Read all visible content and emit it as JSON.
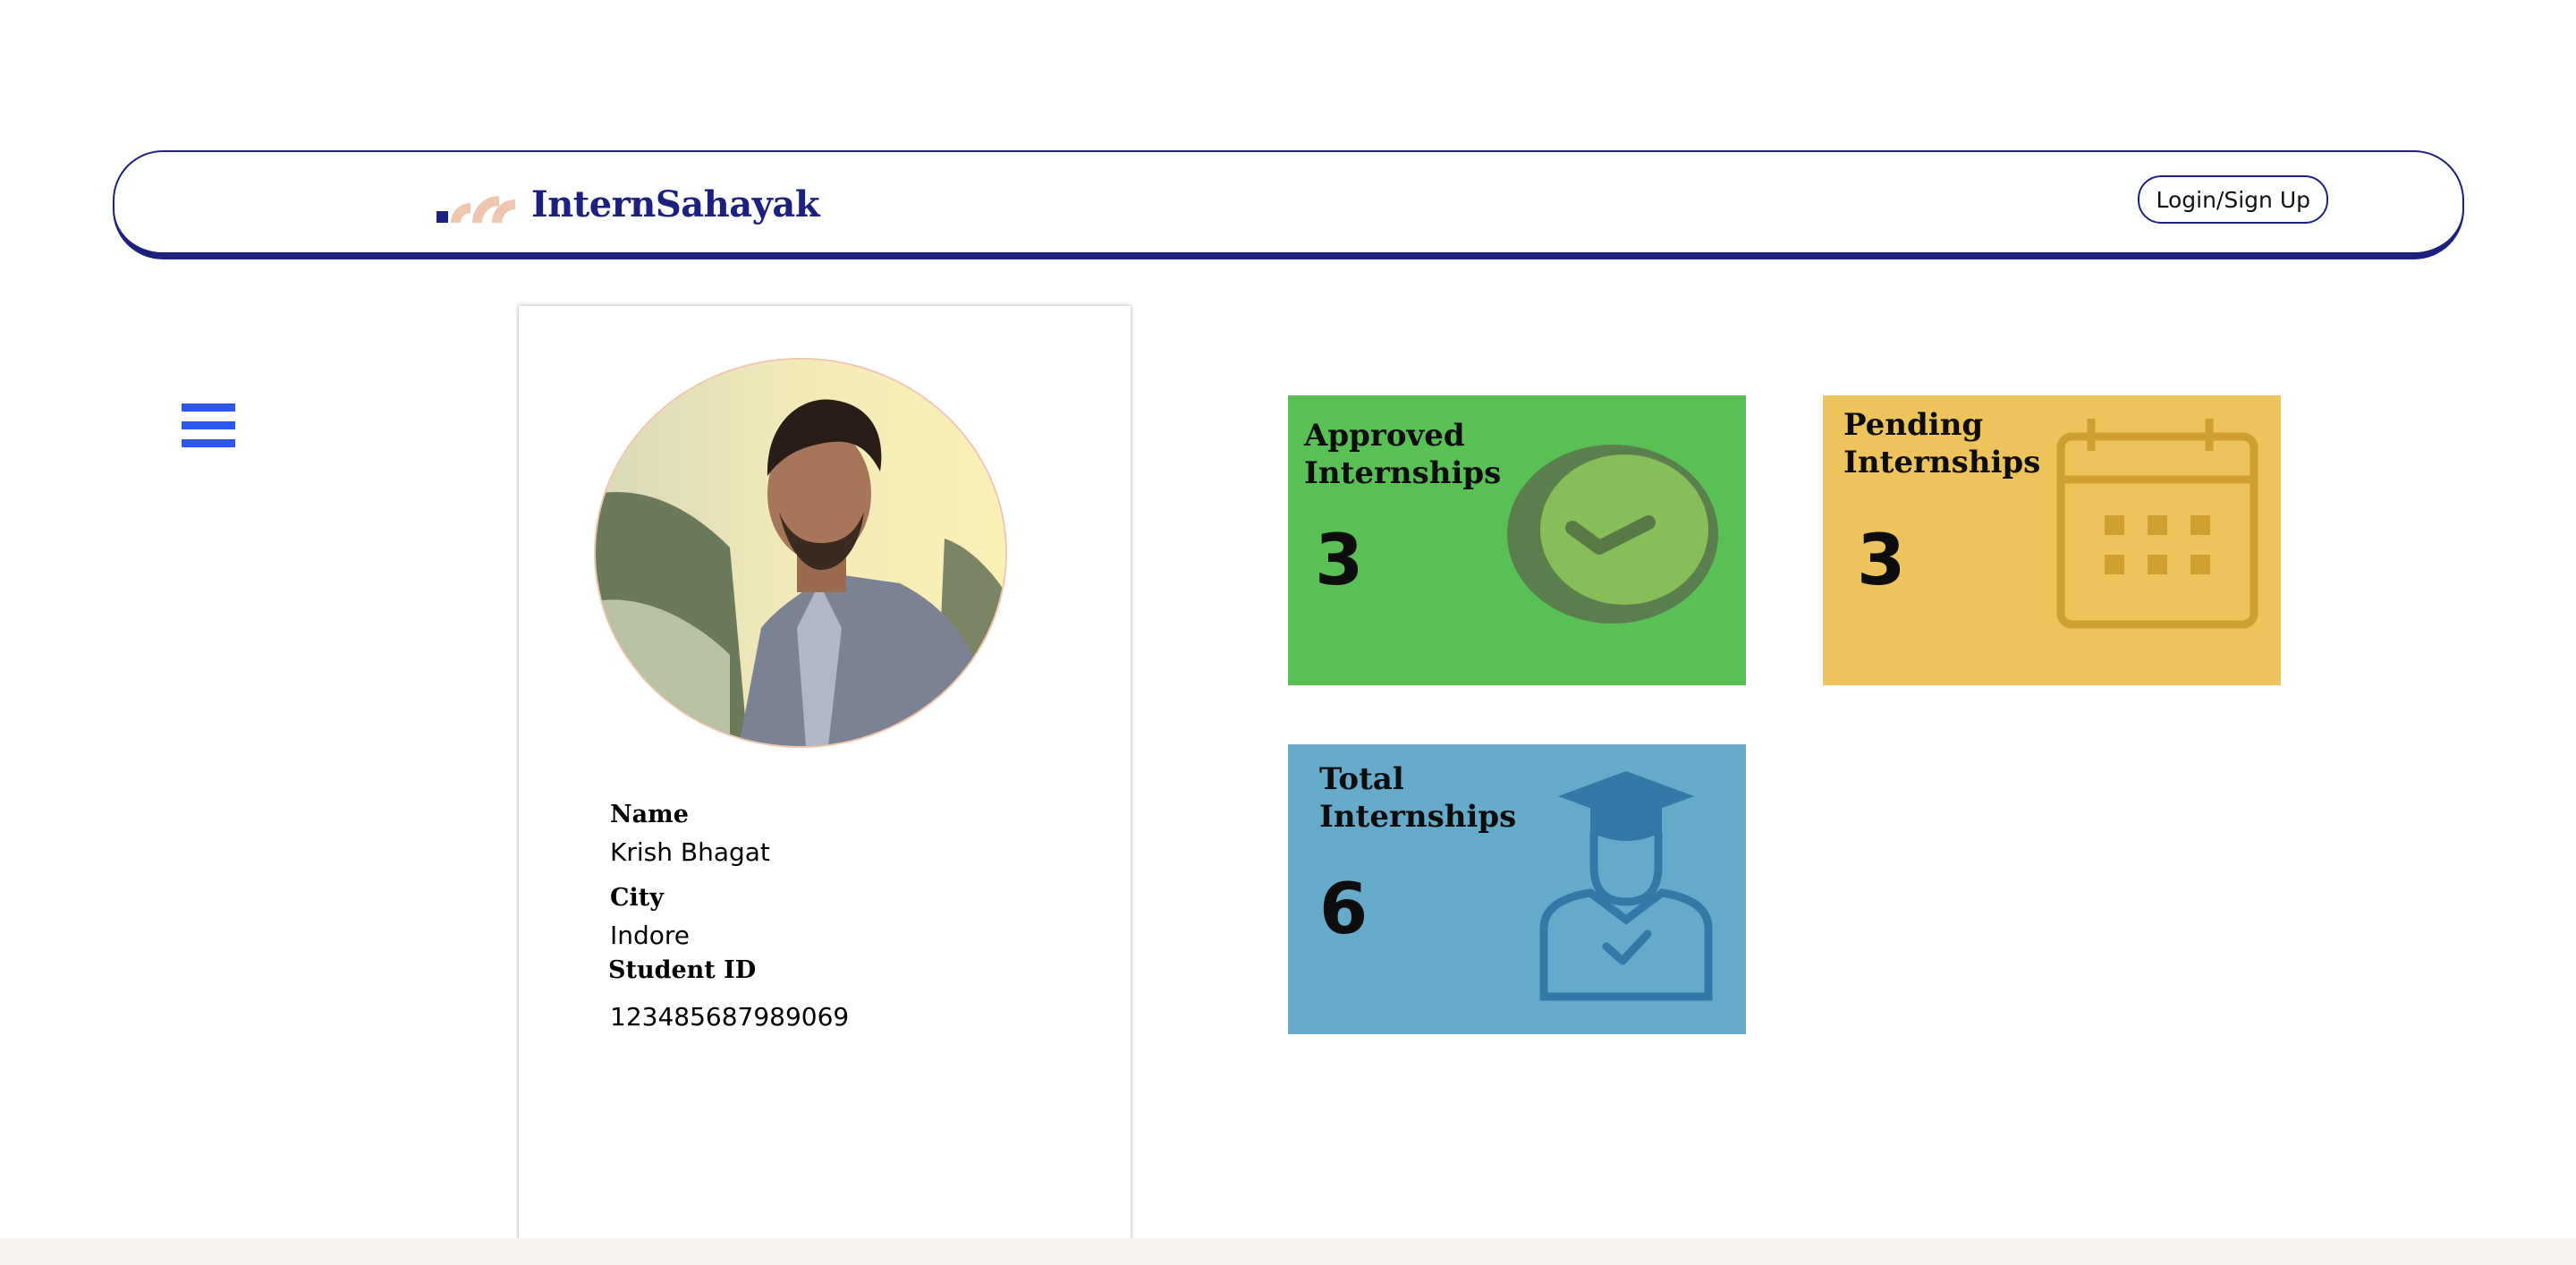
{
  "header": {
    "brand": "InternSahayak",
    "login_label": "Login/Sign Up",
    "brand_color": "#1c2180",
    "logo_icon": "wifi-arcs-logo"
  },
  "menu": {
    "icon": "hamburger-icon",
    "color": "#2b56f0"
  },
  "profile": {
    "avatar_icon": "profile-photo",
    "fields": [
      {
        "label": "Name",
        "value": "Krish Bhagat"
      },
      {
        "label": "City",
        "value": "Indore"
      },
      {
        "label": "Student ID",
        "value": "123485687989069"
      }
    ]
  },
  "cards": {
    "approved": {
      "title_line1": "Approved",
      "title_line2": "Internships",
      "count": "3",
      "color": "#59c055",
      "icon": "check-circle-icon"
    },
    "pending": {
      "title_line1": "Pending",
      "title_line2": "Internships",
      "count": "3",
      "color": "#edc35c",
      "icon": "calendar-icon"
    },
    "total": {
      "title_line1": "Total",
      "title_line2": "Internships",
      "count": "6",
      "color": "#66aaca",
      "icon": "graduate-icon"
    }
  }
}
